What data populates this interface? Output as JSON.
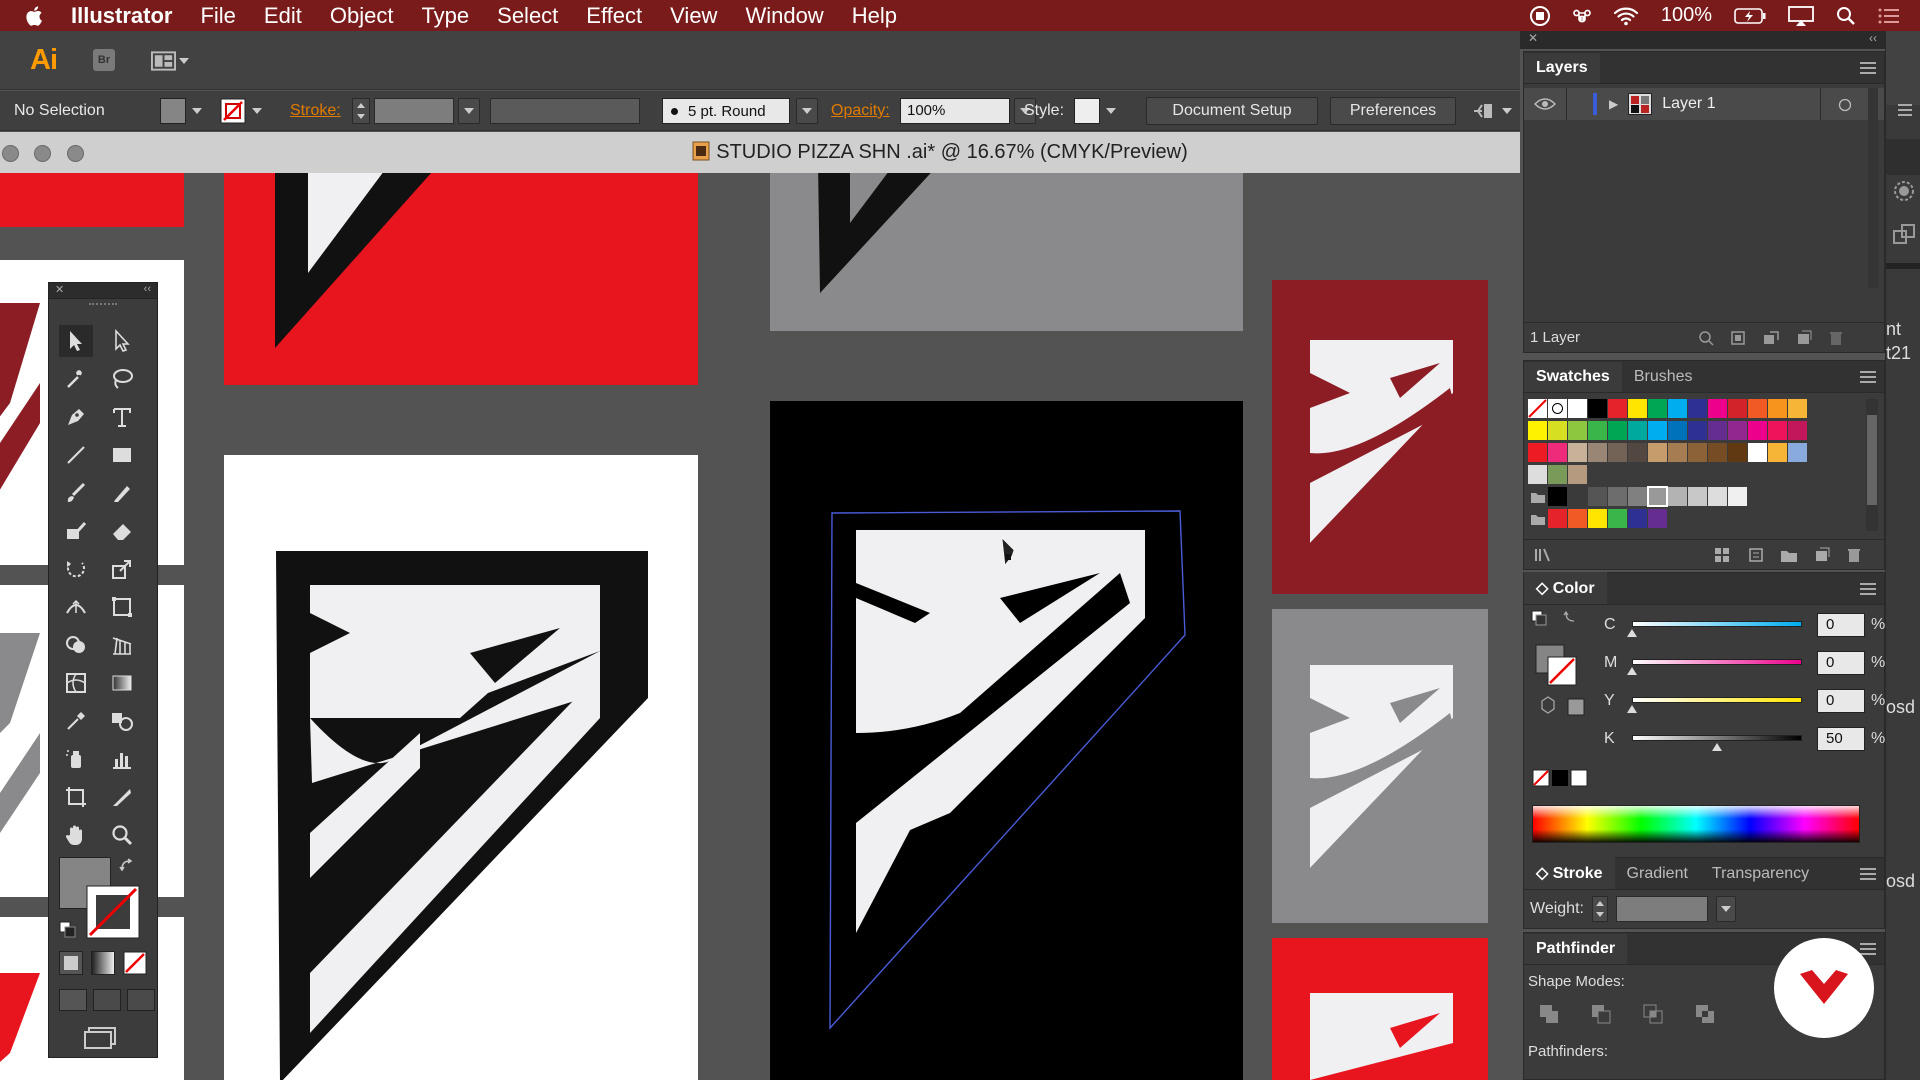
{
  "menubar": {
    "app_name": "Illustrator",
    "items": [
      "File",
      "Edit",
      "Object",
      "Type",
      "Select",
      "Effect",
      "View",
      "Window",
      "Help"
    ],
    "battery": "100%"
  },
  "appbar": {
    "logo": "Ai",
    "bridge": "Br"
  },
  "controlbar": {
    "selection": "No Selection",
    "stroke_label": "Stroke:",
    "brush": "5 pt. Round",
    "opacity_label": "Opacity:",
    "opacity_value": "100%",
    "style_label": "Style:",
    "doc_setup": "Document Setup",
    "preferences": "Preferences"
  },
  "document": {
    "title": "STUDIO PIZZA SHN .ai* @ 16.67% (CMYK/Preview)"
  },
  "layers": {
    "tab": "Layers",
    "layer_name": "Layer 1",
    "count": "1 Layer"
  },
  "swatches": {
    "tabs": [
      "Swatches",
      "Brushes"
    ]
  },
  "color": {
    "tab": "Color",
    "channels": [
      {
        "label": "C",
        "value": "0",
        "pct": 0
      },
      {
        "label": "M",
        "value": "0",
        "pct": 0
      },
      {
        "label": "Y",
        "value": "0",
        "pct": 0
      },
      {
        "label": "K",
        "value": "50",
        "pct": 50
      }
    ],
    "unit": "%"
  },
  "stroke_panel": {
    "tabs": [
      "Stroke",
      "Gradient",
      "Transparency"
    ],
    "weight_label": "Weight:"
  },
  "pathfinder": {
    "tab": "Pathfinder",
    "shape_modes": "Shape Modes:",
    "pathfinders": "Pathfinders:"
  },
  "farright": {
    "lines": [
      "nt",
      "t21",
      "osd",
      "osd"
    ]
  },
  "colors": {
    "menubar": "#7a1b1b",
    "brand_red": "#e8151f",
    "dark_red": "#8c1d25",
    "logo_white": "#f0f0f2",
    "gray_art": "#8a8a8c",
    "selection": "#4a5bd8"
  }
}
